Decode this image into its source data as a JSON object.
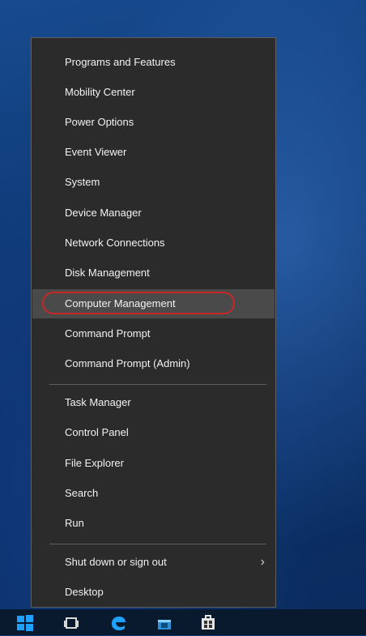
{
  "context_menu": {
    "group1": [
      "Programs and Features",
      "Mobility Center",
      "Power Options",
      "Event Viewer",
      "System",
      "Device Manager",
      "Network Connections",
      "Disk Management",
      "Computer Management",
      "Command Prompt",
      "Command Prompt (Admin)"
    ],
    "group2": [
      "Task Manager",
      "Control Panel",
      "File Explorer",
      "Search",
      "Run"
    ],
    "group3": [
      "Shut down or sign out",
      "Desktop"
    ],
    "hovered_item": "Computer Management",
    "highlight_color": "#c62828"
  },
  "taskbar": {
    "icons": [
      "windows-start-icon",
      "task-view-icon",
      "edge-icon",
      "store-icon",
      "windows-store-icon"
    ]
  }
}
